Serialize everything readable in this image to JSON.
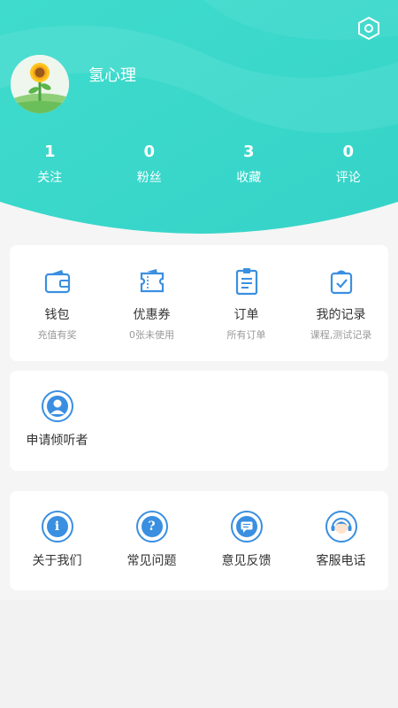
{
  "profile": {
    "username": "氢心理",
    "avatar_icon": "sunflower-icon",
    "settings_icon": "settings-hexagon-icon"
  },
  "stats": [
    {
      "value": "1",
      "label": "关注"
    },
    {
      "value": "0",
      "label": "粉丝"
    },
    {
      "value": "3",
      "label": "收藏"
    },
    {
      "value": "0",
      "label": "评论"
    }
  ],
  "services": [
    {
      "title": "钱包",
      "subtitle": "充值有奖",
      "icon": "wallet-icon"
    },
    {
      "title": "优惠券",
      "subtitle": "0张未使用",
      "icon": "coupon-icon"
    },
    {
      "title": "订单",
      "subtitle": "所有订单",
      "icon": "order-icon"
    },
    {
      "title": "我的记录",
      "subtitle": "课程,测试记录",
      "icon": "record-bag-icon"
    }
  ],
  "listener": {
    "label": "申请倾听者",
    "icon": "listener-person-icon"
  },
  "help": [
    {
      "label": "关于我们",
      "icon": "info-icon"
    },
    {
      "label": "常见问题",
      "icon": "question-icon"
    },
    {
      "label": "意见反馈",
      "icon": "feedback-icon"
    },
    {
      "label": "客服电话",
      "icon": "customer-service-icon"
    }
  ],
  "colors": {
    "header_gradient_start": "#30d6c9",
    "header_gradient_end": "#4ee2d2",
    "accent_blue": "#3a8fe0"
  }
}
